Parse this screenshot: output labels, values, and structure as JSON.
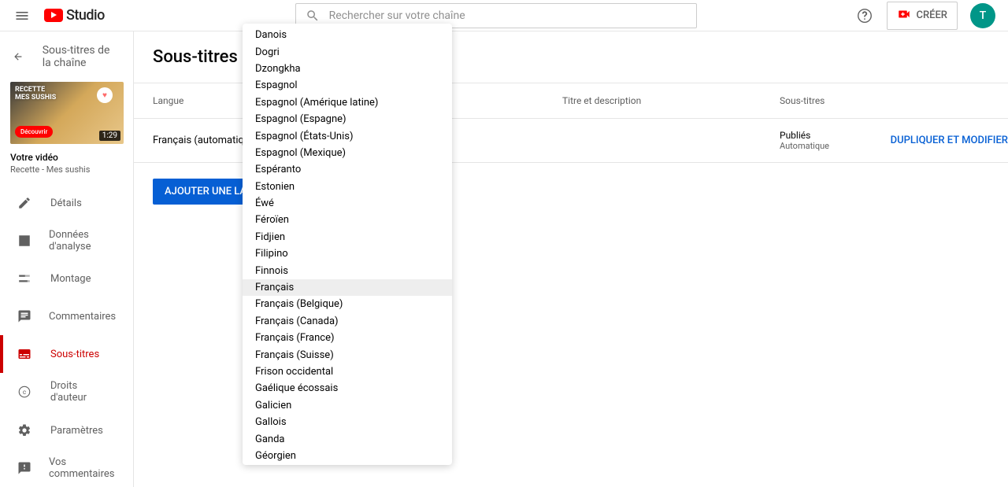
{
  "header": {
    "logo_text": "Studio",
    "search_placeholder": "Rechercher sur votre chaîne",
    "create_label": "CRÉER",
    "avatar_initial": "T"
  },
  "sidebar": {
    "back_label": "Sous-titres de la chaîne",
    "video_label": "Votre vidéo",
    "video_title": "Recette - Mes sushis",
    "thumb_line1": "RECETTE",
    "thumb_line2": "MES SUSHIS",
    "thumb_discover": "Découvrir",
    "thumb_duration": "1:29",
    "nav": [
      {
        "label": "Détails"
      },
      {
        "label": "Données d'analyse"
      },
      {
        "label": "Montage"
      },
      {
        "label": "Commentaires"
      },
      {
        "label": "Sous-titres"
      },
      {
        "label": "Droits d'auteur"
      }
    ],
    "bottom": [
      {
        "label": "Paramètres"
      },
      {
        "label": "Vos commentaires"
      }
    ]
  },
  "main": {
    "title": "Sous-titres de la",
    "columns": {
      "langue": "Langue",
      "titre": "Titre et description",
      "sous": "Sous-titres"
    },
    "row": {
      "langue": "Français (automatique)",
      "status": "Publiés",
      "auto": "Automatique",
      "action": "DUPLIQUER ET MODIFIER"
    },
    "add_lang": "AJOUTER UNE LANGUE"
  },
  "dropdown": {
    "highlighted": "Français",
    "items": [
      "Danois",
      "Dogri",
      "Dzongkha",
      "Espagnol",
      "Espagnol (Amérique latine)",
      "Espagnol (Espagne)",
      "Espagnol (États-Unis)",
      "Espagnol (Mexique)",
      "Espéranto",
      "Estonien",
      "Éwé",
      "Féroïen",
      "Fidjien",
      "Filipino",
      "Finnois",
      "Français",
      "Français (Belgique)",
      "Français (Canada)",
      "Français (France)",
      "Français (Suisse)",
      "Frison occidental",
      "Gaélique écossais",
      "Galicien",
      "Gallois",
      "Ganda",
      "Géorgien"
    ]
  }
}
